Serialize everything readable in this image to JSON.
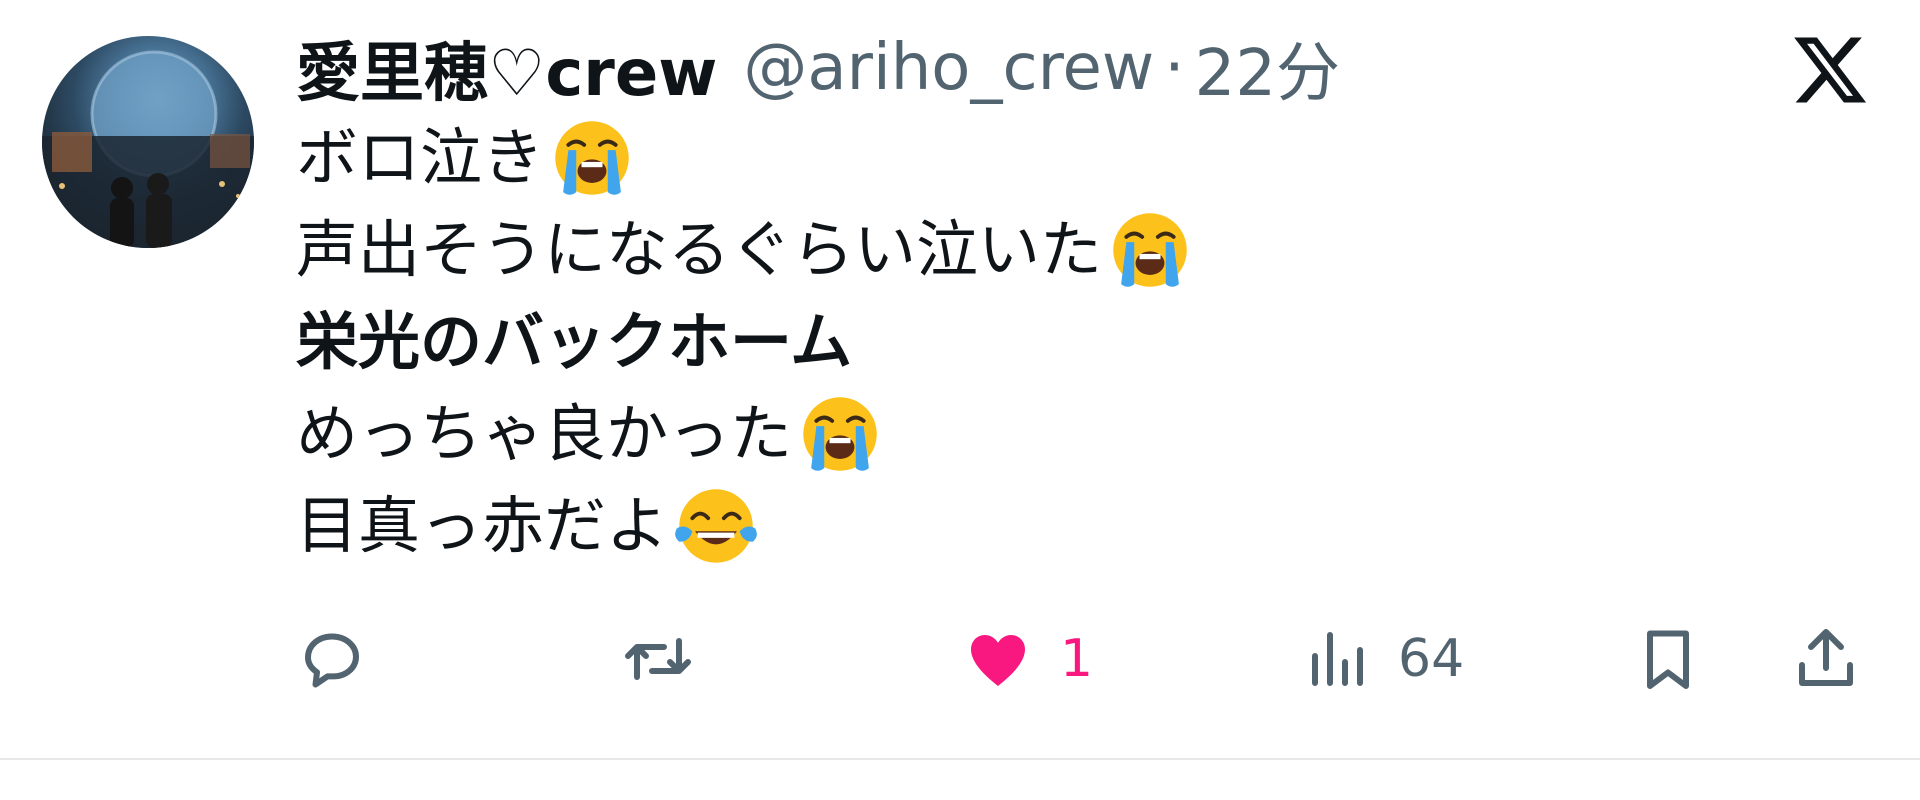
{
  "tweet": {
    "display_name": "愛里穂♡crew",
    "handle": "@ariho_crew",
    "separator": "·",
    "time": "22分",
    "lines": [
      {
        "text": "ボロ泣き",
        "emoji": "loudly-crying-face"
      },
      {
        "text": "声出そうになるぐらい泣いた",
        "emoji": "loudly-crying-face"
      },
      {
        "text": "栄光のバックホーム",
        "emoji": ""
      },
      {
        "text": "めっちゃ良かった",
        "emoji": "loudly-crying-face"
      },
      {
        "text": "目真っ赤だよ",
        "emoji": "face-with-tears-of-joy"
      }
    ],
    "actions": {
      "reply_count": "",
      "retweet_count": "",
      "like_count": "1",
      "views_count": "64"
    }
  },
  "icons": {
    "platform": "x-logo-icon",
    "reply": "speech-bubble-icon",
    "retweet": "retweet-arrows-icon",
    "like": "heart-icon",
    "views": "bar-chart-icon",
    "bookmark": "bookmark-icon",
    "share": "share-upload-icon"
  },
  "colors": {
    "text": "#0f1419",
    "muted": "#536471",
    "like": "#f91880",
    "divider": "#e6e8ea"
  }
}
